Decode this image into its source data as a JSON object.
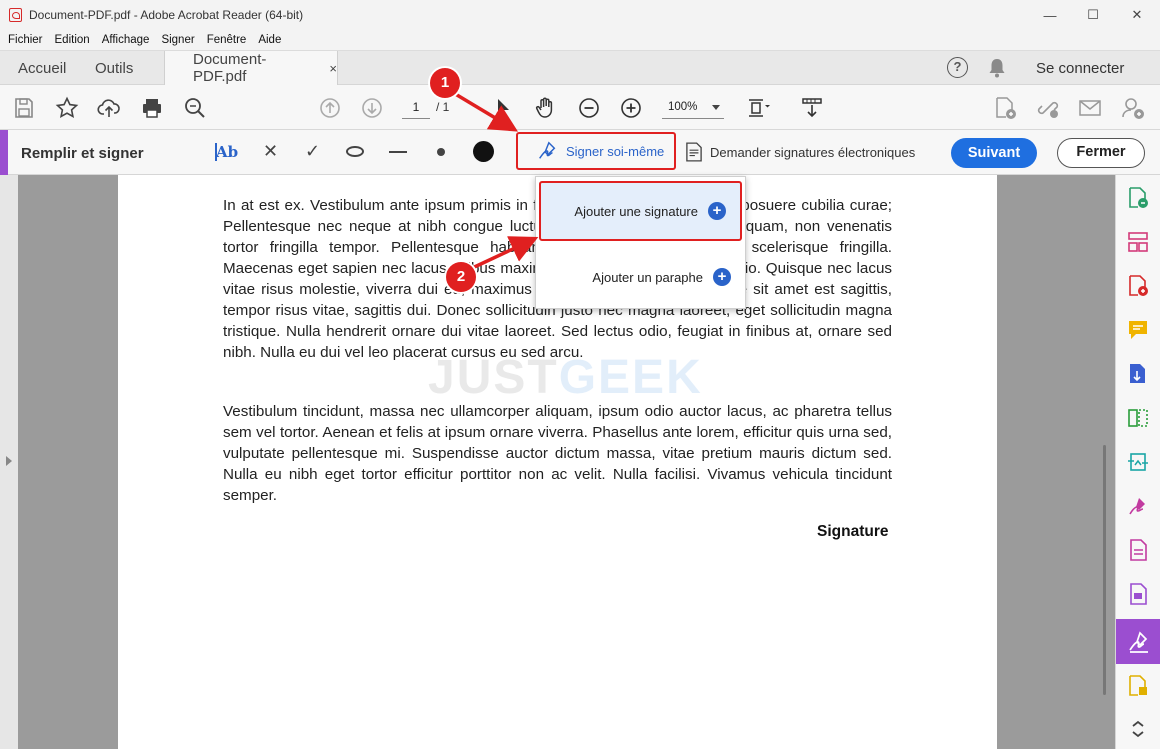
{
  "window": {
    "title": "Document-PDF.pdf - Adobe Acrobat Reader (64-bit)",
    "controls": [
      "—",
      "☐",
      "✕"
    ]
  },
  "menu": [
    "Fichier",
    "Edition",
    "Affichage",
    "Signer",
    "Fenêtre",
    "Aide"
  ],
  "tabs": {
    "home": "Accueil",
    "tools": "Outils",
    "document": "Document-PDF.pdf",
    "close": "×"
  },
  "header": {
    "help": "?",
    "connect": "Se connecter"
  },
  "toolbar": {
    "page_current": "1",
    "page_total": "/ 1",
    "zoom": "100%"
  },
  "fill_sign": {
    "title": "Remplir et signer",
    "text_tool": "Ab",
    "cross": "✕",
    "check": "✓",
    "sign_self": "Signer soi-même",
    "request_signatures": "Demander signatures électroniques",
    "next": "Suivant",
    "close": "Fermer"
  },
  "dropdown": {
    "add_signature": "Ajouter une signature",
    "add_initials": "Ajouter un paraphe",
    "plus": "+"
  },
  "document": {
    "paragraph1": "In at est ex. Vestibulum ante ipsum primis in faucibus orci luctus et ultrices posuere cubilia curae; Pellentesque nec neque at nibh congue luctus. Aliquam volutpat euismod quam, non venenatis tortor fringilla tempor. Pellentesque habitant morbi, a commodo dolor scelerisque fringilla. Maecenas eget sapien nec lacus finibus maximus nisl. Aenean sed luctus odio. Quisque nec lacus vitae risus molestie, viverra dui eu, maximus orci. In id lectus ipsum. Fusce sit amet est sagittis, tempor risus vitae, sagittis dui. Donec sollicitudin justo nec magna laoreet, eget sollicitudin magna tristique. Nulla hendrerit ornare dui vitae laoreet. Sed lectus odio, feugiat in finibus at, ornare sed nibh. Nulla eu dui vel leo placerat cursus eu sed arcu.",
    "paragraph2": "Vestibulum tincidunt, massa nec ullamcorper aliquam, ipsum odio auctor lacus, ac pharetra tellus sem vel tortor. Aenean et felis at ipsum ornare viverra. Phasellus ante lorem, efficitur quis urna sed, vulputate pellentesque mi. Suspendisse auctor dictum massa, vitae pretium mauris dictum sed. Nulla eu nibh eget tortor efficitur porttitor non ac velit. Nulla facilisi. Vivamus vehicula tincidunt semper.",
    "signature_label": "Signature",
    "watermark_a": "JUST",
    "watermark_b": "GEEK"
  },
  "annotations": {
    "step1": "1",
    "step2": "2"
  },
  "colors": {
    "accent_purple": "#9b4ed0",
    "primary_blue": "#1f6fe0",
    "link_blue": "#2a63c9",
    "highlight_red": "#e02020"
  },
  "icons": {
    "toolbar": [
      "save-icon",
      "star-icon",
      "upload-icon",
      "print-icon",
      "search-icon",
      "page-up-icon",
      "page-down-icon",
      "select-arrow-icon",
      "hand-icon",
      "zoom-out-icon",
      "zoom-in-icon",
      "fit-page-icon",
      "scroll-mode-icon",
      "export-pdf-icon",
      "share-link-icon",
      "mail-icon",
      "account-icon"
    ],
    "right_rail": [
      "export-pdf-icon",
      "organize-pages-icon",
      "create-pdf-icon",
      "comment-icon",
      "compress-icon",
      "edit-pdf-icon",
      "convert-icon",
      "sign-icon",
      "form-icon",
      "protect-icon",
      "fill-sign-icon",
      "more-tools-icon"
    ]
  }
}
